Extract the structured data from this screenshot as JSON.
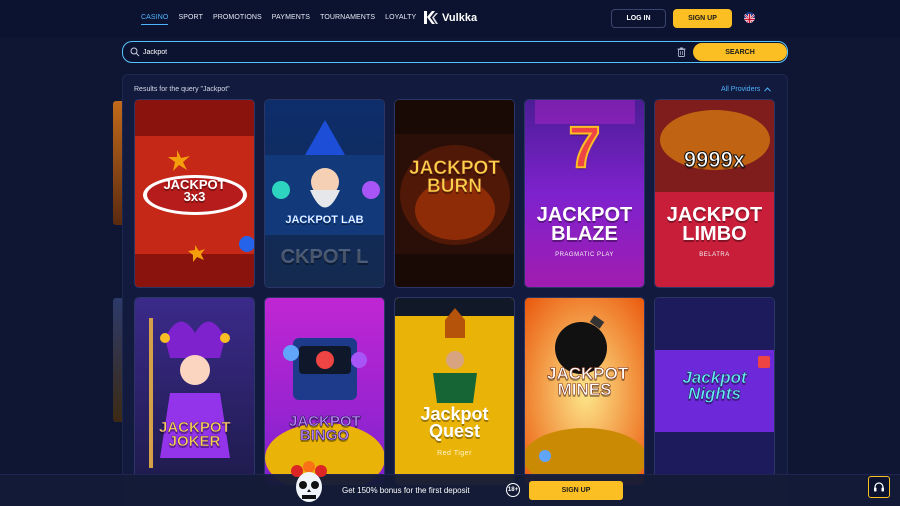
{
  "header": {
    "nav": [
      "CASINO",
      "SPORT",
      "PROMOTIONS",
      "PAYMENTS",
      "TOURNAMENTS",
      "LOYALTY"
    ],
    "logo": "Vulkka",
    "login_label": "LOG IN",
    "signup_label": "SIGN UP",
    "language_icon": "uk-flag-icon"
  },
  "search": {
    "value": "Jackpot",
    "button_label": "SEARCH"
  },
  "results": {
    "title": "Results for the query \"Jackpot\"",
    "providers_label": "All Providers",
    "games": [
      {
        "name": "JACKPOT 3x3",
        "provider": ""
      },
      {
        "name": "JACKPOT LAB",
        "provider": ""
      },
      {
        "name": "JACKPOT BURN",
        "provider": ""
      },
      {
        "name": "JACKPOT BLAZE",
        "provider": "PRAGMATIC PLAY"
      },
      {
        "name": "JACKPOT LIMBO",
        "provider": "BELATRA"
      },
      {
        "name": "JACKPOT JOKER",
        "provider": ""
      },
      {
        "name": "JACKPOT BINGO",
        "provider": ""
      },
      {
        "name": "Jackpot Quest",
        "provider": "Red Tiger"
      },
      {
        "name": "JACKPOT MINES",
        "provider": ""
      },
      {
        "name": "Jackpot Nights",
        "provider": ""
      }
    ],
    "tile_badges": {
      "blaze_top": "7",
      "limbo_top": "9999x",
      "lab_text": "JACKPOT LAB",
      "lab_bg_text": "CKPOT L"
    }
  },
  "footer": {
    "promo": "Get 150% bonus for the first deposit",
    "age": "18+",
    "signup_label": "SIGN UP",
    "support_icon": "headset-icon"
  },
  "colors": {
    "accent": "#fbbf24",
    "link": "#4fb3ff",
    "background": "#0f1633"
  }
}
